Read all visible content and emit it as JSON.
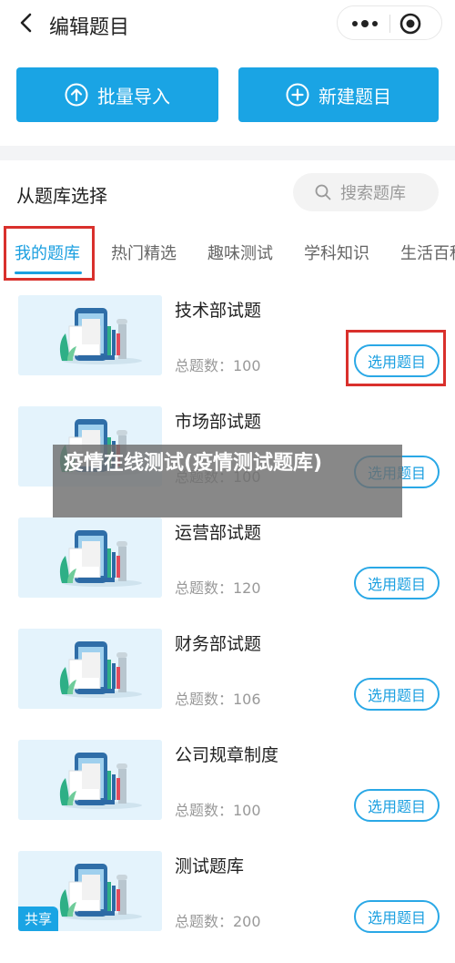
{
  "header": {
    "title": "编辑题目"
  },
  "actions": {
    "import_label": "批量导入",
    "new_label": "新建题目"
  },
  "library": {
    "title": "从题库选择",
    "search_placeholder": "搜索题库",
    "tabs": [
      "我的题库",
      "热门精选",
      "趣味测试",
      "学科知识",
      "生活百科"
    ],
    "items": [
      {
        "name": "技术部试题",
        "count": "总题数：100",
        "button": "选用题目"
      },
      {
        "name": "市场部试题",
        "count": "总题数：100",
        "button": "选用题目"
      },
      {
        "name": "运营部试题",
        "count": "总题数：120",
        "button": "选用题目"
      },
      {
        "name": "财务部试题",
        "count": "总题数：106",
        "button": "选用题目"
      },
      {
        "name": "公司规章制度",
        "count": "总题数：100",
        "button": "选用题目"
      },
      {
        "name": "测试题库",
        "count": "总题数：200",
        "button": "选用题目",
        "badge": "共享"
      }
    ]
  },
  "overlay_caption": "疫情在线测试(疫情测试题库)",
  "colors": {
    "accent": "#1aa4e4",
    "highlight": "#d9302c"
  }
}
